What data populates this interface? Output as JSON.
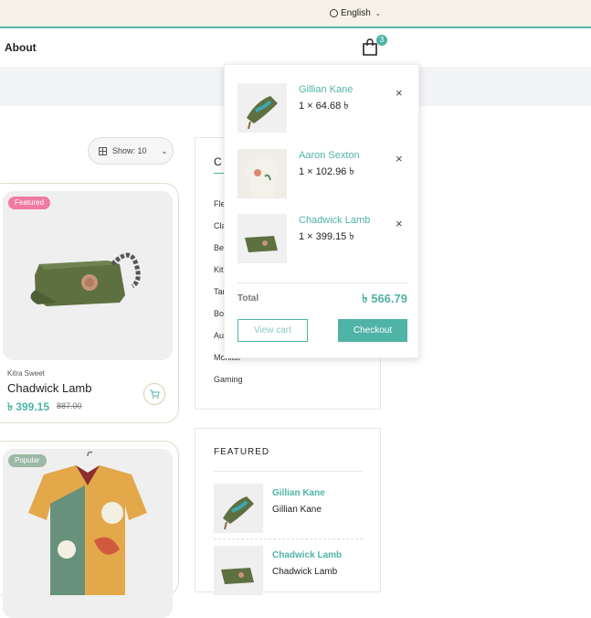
{
  "topbar": {
    "language": "English"
  },
  "nav": {
    "about": "About",
    "cart_count": "3"
  },
  "toolbar": {
    "show_label": "Show: 10"
  },
  "categories": {
    "title": "C",
    "items": [
      "Fle",
      "Cla",
      "Be",
      "Kit",
      "Tar",
      "Bo",
      "Au",
      "Monitor",
      "Gaming"
    ]
  },
  "products": [
    {
      "badge": "Featured",
      "brand": "Kitra Sweet",
      "name": "Chadwick Lamb",
      "price": "৳ 399.15",
      "old_price": "887.00"
    },
    {
      "badge": "Popular"
    }
  ],
  "featured": {
    "title": "FEATURED",
    "items": [
      {
        "name": "Gillian Kane",
        "subtitle": "Gillian Kane"
      },
      {
        "name": "Chadwick Lamb",
        "subtitle": "Chadwick Lamb"
      }
    ]
  },
  "cart_dropdown": {
    "items": [
      {
        "name": "Gillian Kane",
        "qty_price": "1 × 64.68 ৳"
      },
      {
        "name": "Aaron Sexton",
        "qty_price": "1 × 102.96 ৳"
      },
      {
        "name": "Chadwick Lamb",
        "qty_price": "1 × 399.15 ৳"
      }
    ],
    "total_label": "Total",
    "total": "৳ 566.79",
    "view_cart": "View cart",
    "checkout": "Checkout"
  },
  "colors": {
    "accent": "#4fb3a6",
    "topbar_bg": "#f7f2e7",
    "featured_badge": "#f07aa0",
    "popular_badge": "#9bb9a4"
  }
}
